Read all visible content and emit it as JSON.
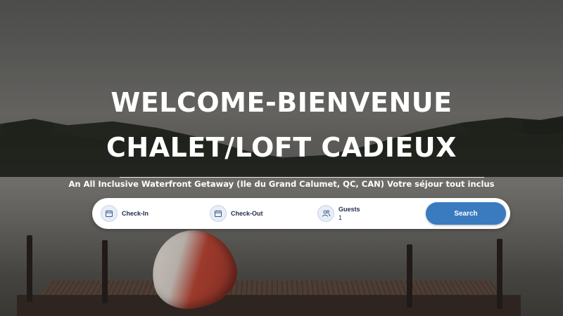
{
  "hero": {
    "title_line1": "WELCOME-BIENVENUE",
    "title_line2": "CHALET/LOFT CADIEUX",
    "subtitle": "An All Inclusive Waterfront Getaway (Ile du Grand Calumet, QC, CAN) Votre séjour tout inclus"
  },
  "search": {
    "checkin_label": "Check-In",
    "checkout_label": "Check-Out",
    "guests_label": "Guests",
    "guests_value": "1",
    "button_label": "Search",
    "icons": {
      "checkin": "calendar-icon",
      "checkout": "calendar-icon",
      "guests": "users-icon"
    },
    "button_color": "#3a7bc0"
  }
}
